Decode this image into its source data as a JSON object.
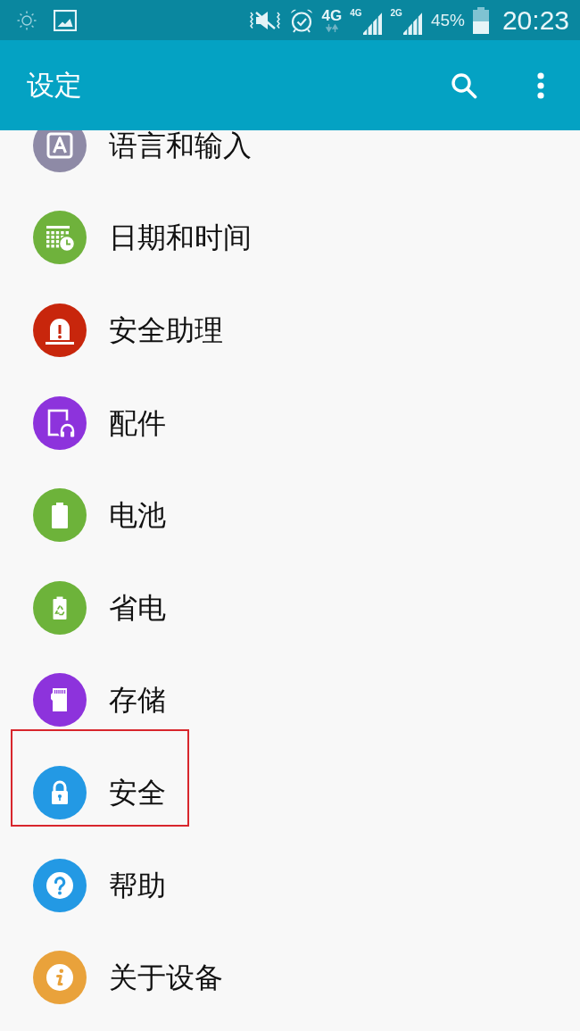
{
  "status_bar": {
    "network_type": "4G",
    "signals": [
      {
        "label": "4G"
      },
      {
        "label": "2G"
      }
    ],
    "battery_percent": "45%",
    "time": "20:23"
  },
  "app_bar": {
    "title": "设定"
  },
  "items": [
    {
      "label": "语言和输入",
      "color": "#8e8aa6",
      "highlighted": false
    },
    {
      "label": "日期和时间",
      "color": "#6fb23c",
      "highlighted": false
    },
    {
      "label": "安全助理",
      "color": "#c8260c",
      "highlighted": false
    },
    {
      "label": "配件",
      "color": "#8d33dc",
      "highlighted": false
    },
    {
      "label": "电池",
      "color": "#6db33a",
      "highlighted": false
    },
    {
      "label": "省电",
      "color": "#6db33a",
      "highlighted": false
    },
    {
      "label": "存储",
      "color": "#8d33dc",
      "highlighted": false
    },
    {
      "label": "安全",
      "color": "#2399e4",
      "highlighted": true
    },
    {
      "label": "帮助",
      "color": "#2399e4",
      "highlighted": false
    },
    {
      "label": "关于设备",
      "color": "#e9a23b",
      "highlighted": false
    }
  ]
}
